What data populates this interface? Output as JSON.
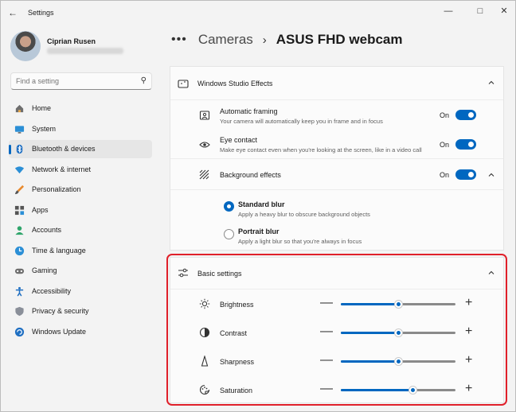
{
  "window": {
    "title": "Settings"
  },
  "profile": {
    "name": "Ciprian Rusen"
  },
  "search": {
    "placeholder": "Find a setting"
  },
  "nav": {
    "items": [
      {
        "label": "Home",
        "icon": "home-icon"
      },
      {
        "label": "System",
        "icon": "monitor-icon"
      },
      {
        "label": "Bluetooth & devices",
        "icon": "bluetooth-icon"
      },
      {
        "label": "Network & internet",
        "icon": "wifi-icon"
      },
      {
        "label": "Personalization",
        "icon": "brush-icon"
      },
      {
        "label": "Apps",
        "icon": "apps-icon"
      },
      {
        "label": "Accounts",
        "icon": "person-icon"
      },
      {
        "label": "Time & language",
        "icon": "globe-clock-icon"
      },
      {
        "label": "Gaming",
        "icon": "gamepad-icon"
      },
      {
        "label": "Accessibility",
        "icon": "accessibility-icon"
      },
      {
        "label": "Privacy & security",
        "icon": "shield-icon"
      },
      {
        "label": "Windows Update",
        "icon": "update-icon"
      }
    ],
    "active": "Bluetooth & devices"
  },
  "breadcrumb": {
    "parent": "Cameras",
    "current": "ASUS FHD webcam"
  },
  "studio": {
    "title": "Windows Studio Effects",
    "auto_framing": {
      "title": "Automatic framing",
      "desc": "Your camera will automatically keep you in frame and in focus",
      "state": "On"
    },
    "eye_contact": {
      "title": "Eye contact",
      "desc": "Make eye contact even when you're looking at the screen, like in a video call",
      "state": "On"
    },
    "background": {
      "title": "Background effects",
      "state": "On"
    },
    "standard_blur": {
      "title": "Standard blur",
      "desc": "Apply a heavy blur to obscure background objects",
      "selected": true
    },
    "portrait_blur": {
      "title": "Portrait blur",
      "desc": "Apply a light blur so that you're always in focus",
      "selected": false
    }
  },
  "basic": {
    "title": "Basic settings",
    "brightness": {
      "label": "Brightness",
      "value": 0.5
    },
    "contrast": {
      "label": "Contrast",
      "value": 0.5
    },
    "sharpness": {
      "label": "Sharpness",
      "value": 0.5
    },
    "saturation": {
      "label": "Saturation",
      "value": 0.63
    }
  },
  "colors": {
    "accent": "#0067c0",
    "highlight": "#e0202a"
  }
}
